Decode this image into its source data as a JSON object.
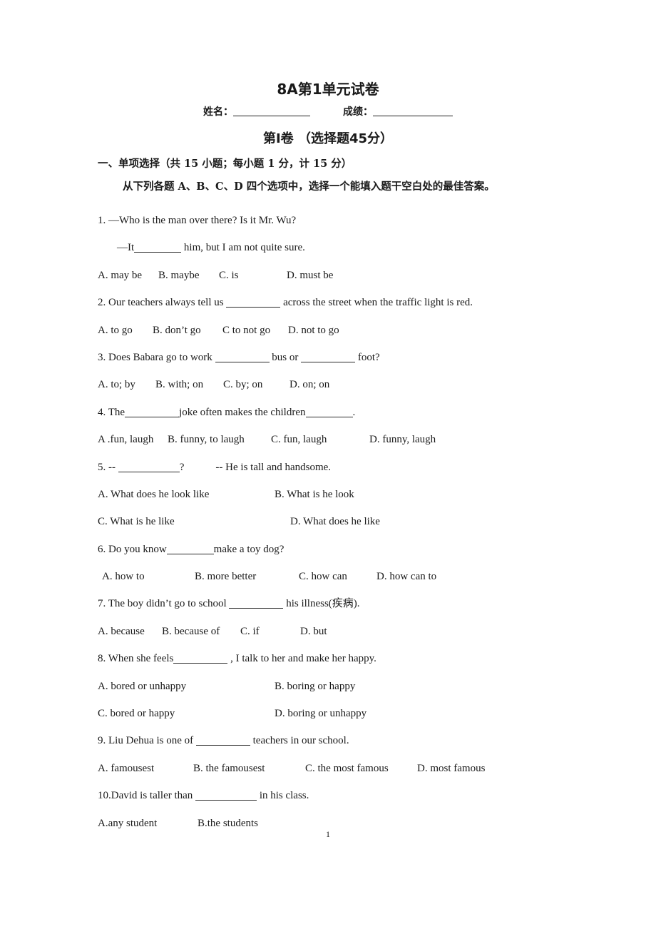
{
  "document": {
    "title": "8A第1单元试卷",
    "name_label": "姓名：",
    "score_label": "成绩：",
    "part_title": "第I卷 （选择题45分）",
    "page_number": "1"
  },
  "section": {
    "heading": "一、单项选择（共 15 小题；每小题 1 分，计 15 分）",
    "instruction": "从下列各题 A、B、C、D 四个选项中，选择一个能填入题干空白处的最佳答案。"
  },
  "questions": [
    {
      "stem_a": "1. —Who is the man over there? Is it Mr. Wu?",
      "stem_b_pre": "—It",
      "stem_b_post": "him, but I am not quite sure.",
      "options": [
        "A. may be",
        "B. maybe",
        "C. is",
        "D. must be"
      ]
    },
    {
      "stem_pre": "2. Our teachers always tell us",
      "stem_post": "across the street when the traffic light is red.",
      "options": [
        "A. to go",
        "B. don’t go",
        "C to not go",
        "D. not to go"
      ]
    },
    {
      "stem_pre": "3. Does Babara go to work",
      "stem_mid": "bus or",
      "stem_post": "foot?",
      "options": [
        "A. to; by",
        "B. with; on",
        "C. by; on",
        "D. on; on"
      ]
    },
    {
      "stem_pre": "4. The",
      "stem_mid": "joke often makes the children",
      "stem_post": ".",
      "options": [
        "A .fun, laugh",
        "B. funny, to laugh",
        "C. fun, laugh",
        "D. funny, laugh"
      ]
    },
    {
      "stem_pre": "5. --",
      "stem_post": "?",
      "stem_answer": "-- He is tall and handsome.",
      "options": [
        "A. What does he look like",
        "B. What is he look",
        "C. What is he like",
        "D. What does he like"
      ]
    },
    {
      "stem_pre": "6. Do you know",
      "stem_post": "make a toy dog?",
      "options": [
        "A. how to",
        "B. more better",
        "C. how can",
        "D. how can to"
      ]
    },
    {
      "stem_pre": "7. The boy didn’t go to school",
      "stem_post": "his illness(疾病).",
      "options": [
        "A. because",
        "B. because of",
        "C. if",
        "D. but"
      ]
    },
    {
      "stem_pre": "8. When she feels",
      "stem_post": ", I talk to her and make her happy.",
      "options": [
        "A. bored or unhappy",
        "B. boring or happy",
        "C. bored or happy",
        "D. boring or unhappy"
      ]
    },
    {
      "stem_pre": "9. Liu Dehua is one of",
      "stem_post": "teachers in our school.",
      "options": [
        "A. famousest",
        "B. the famousest",
        "C. the most famous",
        "D. most famous"
      ]
    },
    {
      "stem_pre": "10.David is taller than",
      "stem_post": "in his class.",
      "options": [
        "A.any student",
        "B.the students"
      ]
    }
  ]
}
